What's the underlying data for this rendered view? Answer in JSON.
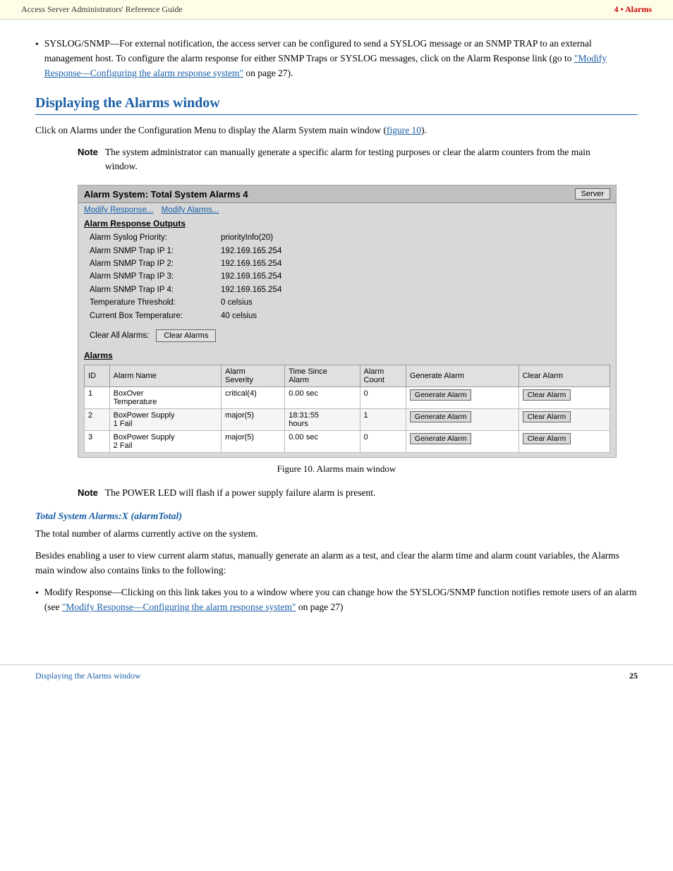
{
  "header": {
    "left": "Access Server Administrators' Reference Guide",
    "right": "4 • Alarms"
  },
  "bullet1": {
    "dot": "•",
    "text_before": "SYSLOG/SNMP—For external notification, the access server can be configured to send a SYSLOG message or an SNMP TRAP to an external management host. To configure the alarm response for either SNMP Traps or SYSLOG messages, click on the Alarm Response link (go to ",
    "link_text": "\"Modify Response—Configuring the alarm response system\"",
    "text_after": " on page 27)."
  },
  "section_heading": "Displaying the Alarms window",
  "intro_para": "Click on Alarms under the Configuration Menu to display the Alarm System main window (figure 10).",
  "note1": {
    "label": "Note",
    "text": "The system administrator can manually generate a specific alarm for testing purposes or clear the alarm counters from the main window."
  },
  "screenshot": {
    "title": "Alarm System: Total System Alarms 4",
    "server_btn": "Server",
    "links": [
      "Modify Response...",
      "Modify Alarms..."
    ],
    "response_outputs_title": "Alarm Response Outputs",
    "info_rows": [
      {
        "label": "Alarm Syslog Priority:",
        "value": "priorityInfo(20)"
      },
      {
        "label": "Alarm SNMP Trap IP 1:",
        "value": "192.169.165.254"
      },
      {
        "label": "Alarm SNMP Trap IP 2:",
        "value": "192.169.165.254"
      },
      {
        "label": "Alarm SNMP Trap IP 3:",
        "value": "192.169.165.254"
      },
      {
        "label": "Alarm SNMP Trap IP 4:",
        "value": "192.169.165.254"
      },
      {
        "label": "Temperature Threshold:",
        "value": "0 celsius"
      },
      {
        "label": "Current Box Temperature:",
        "value": "40 celsius"
      }
    ],
    "clear_all_label": "Clear All Alarms:",
    "clear_alarms_btn": "Clear Alarms",
    "alarms_title": "Alarms",
    "table": {
      "headers": [
        "ID",
        "Alarm Name",
        "Alarm Severity",
        "Time Since Alarm",
        "Alarm Count",
        "Generate Alarm",
        "Clear Alarm"
      ],
      "rows": [
        {
          "id": "1",
          "name": "BoxOver Temperature",
          "severity": "critical(4)",
          "time": "0.00 sec",
          "count": "0",
          "gen_btn": "Generate Alarm",
          "clr_btn": "Clear Alarm"
        },
        {
          "id": "2",
          "name": "BoxPower Supply 1 Fail",
          "severity": "major(5)",
          "time": "18:31:55 hours",
          "count": "1",
          "gen_btn": "Generate Alarm",
          "clr_btn": "Clear Alarm"
        },
        {
          "id": "3",
          "name": "BoxPower Supply 2 Fail",
          "severity": "major(5)",
          "time": "0.00 sec",
          "count": "0",
          "gen_btn": "Generate Alarm",
          "clr_btn": "Clear Alarm"
        }
      ]
    }
  },
  "figure_caption": "Figure 10. Alarms main window",
  "note2": {
    "label": "Note",
    "text": "The POWER LED will flash if a power supply failure alarm is present."
  },
  "subsection_heading": "Total System Alarms:X (alarmTotal)",
  "subsection_para1": "The total number of alarms currently active on the system.",
  "subsection_para2": "Besides enabling a user to view current alarm status, manually generate an alarm as a test, and clear the alarm time and alarm count variables, the Alarms main window also contains links to the following:",
  "bullet2": {
    "dot": "•",
    "text_before": "Modify Response—Clicking on this link takes you to a window where you can change how the SYSLOG/SNMP function notifies remote users of an alarm (see ",
    "link_text": "\"Modify Response—Configuring the alarm response system\"",
    "text_after": " on page 27)"
  },
  "footer": {
    "left": "Displaying the Alarms window",
    "right": "25"
  }
}
